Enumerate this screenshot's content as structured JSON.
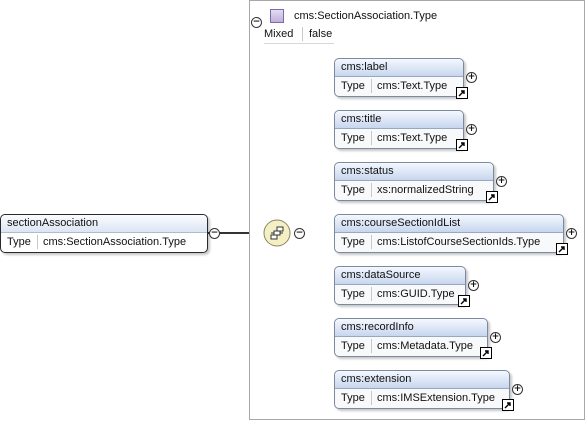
{
  "root_element": {
    "name": "sectionAssociation",
    "type_label": "Type",
    "type_value": "cms:SectionAssociation.Type",
    "toggle": "−"
  },
  "complex_type": {
    "name": "cms:SectionAssociation.Type",
    "toggle": "−",
    "property_name": "Mixed",
    "property_value": "false"
  },
  "sequence": {
    "icon": "sequence-compositor-icon",
    "toggle": "−"
  },
  "children": [
    {
      "name": "cms:label",
      "type_label": "Type",
      "type_value": "cms:Text.Type",
      "toggle": "+"
    },
    {
      "name": "cms:title",
      "type_label": "Type",
      "type_value": "cms:Text.Type",
      "toggle": "+"
    },
    {
      "name": "cms:status",
      "type_label": "Type",
      "type_value": "xs:normalizedString",
      "toggle": "+"
    },
    {
      "name": "cms:courseSectionIdList",
      "type_label": "Type",
      "type_value": "cms:ListofCourseSectionIds.Type",
      "toggle": "+"
    },
    {
      "name": "cms:dataSource",
      "type_label": "Type",
      "type_value": "cms:GUID.Type",
      "toggle": "+"
    },
    {
      "name": "cms:recordInfo",
      "type_label": "Type",
      "type_value": "cms:Metadata.Type",
      "toggle": "+"
    },
    {
      "name": "cms:extension",
      "type_label": "Type",
      "type_value": "cms:IMSExtension.Type",
      "toggle": "+"
    }
  ]
}
